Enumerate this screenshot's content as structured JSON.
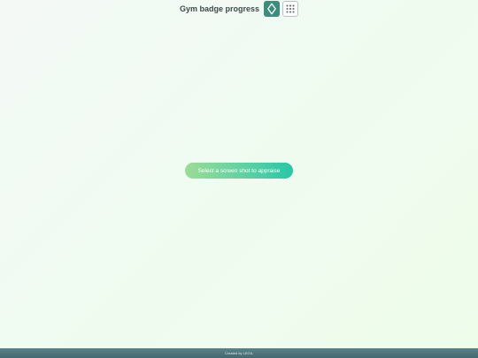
{
  "header": {
    "title": "Gym badge progress",
    "badge_icon": "diamond-badge-icon",
    "apps_icon": "grid-apps-icon",
    "accent_color": "#3c8e7c"
  },
  "main": {
    "select_button_label": "Select a screen shot to appraise"
  },
  "footer": {
    "credit": "Created by LEGIL"
  }
}
